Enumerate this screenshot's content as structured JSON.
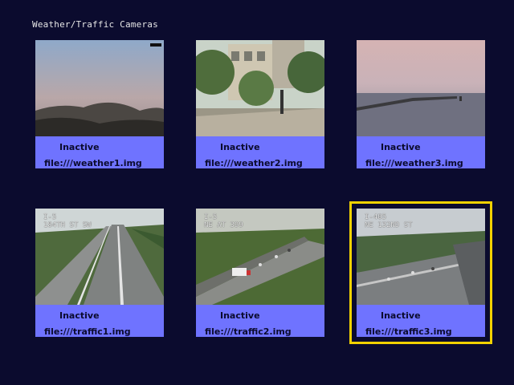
{
  "title": "Weather/Traffic Cameras",
  "colors": {
    "background": "#0b0b2e",
    "info_panel": "#6f73ff",
    "selection": "#f2d200"
  },
  "cameras": [
    {
      "status": "Inactive",
      "file": "file:///weather1.img",
      "selected": false
    },
    {
      "status": "Inactive",
      "file": "file:///weather2.img",
      "selected": false
    },
    {
      "status": "Inactive",
      "file": "file:///weather3.img",
      "selected": false
    },
    {
      "status": "Inactive",
      "file": "file:///traffic1.img",
      "selected": false,
      "overlay": [
        "I-5",
        "184TH ST SW"
      ]
    },
    {
      "status": "Inactive",
      "file": "file:///traffic2.img",
      "selected": false,
      "overlay": [
        "I-5",
        "NE AT 399"
      ]
    },
    {
      "status": "Inactive",
      "file": "file:///traffic3.img",
      "selected": true,
      "overlay": [
        "I-405",
        "NE 132ND ST"
      ]
    }
  ]
}
